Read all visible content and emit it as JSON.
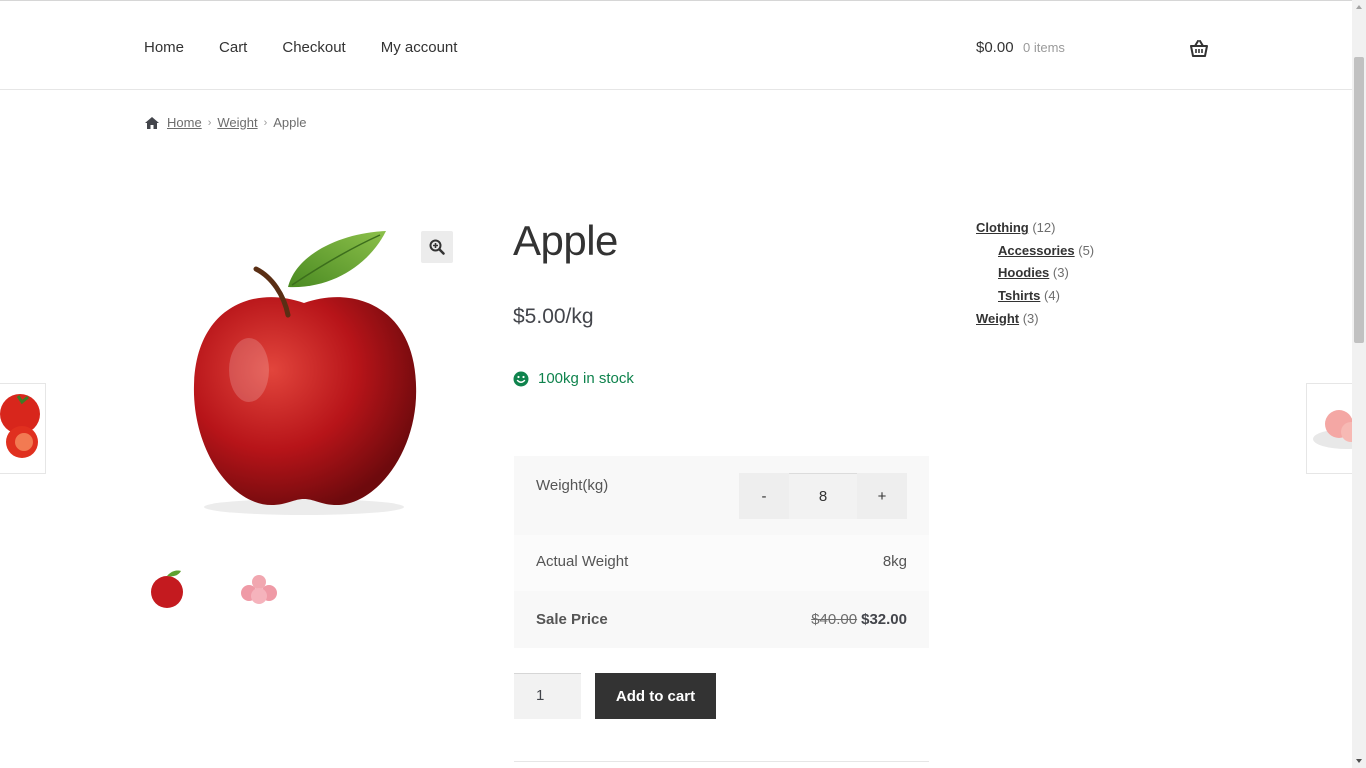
{
  "nav": {
    "items": [
      {
        "label": "Home"
      },
      {
        "label": "Cart"
      },
      {
        "label": "Checkout"
      },
      {
        "label": "My account"
      }
    ]
  },
  "mini_cart": {
    "amount": "$0.00",
    "count": "0 items",
    "icon": "basket-icon"
  },
  "breadcrumb": {
    "icon": "home-icon",
    "items": [
      "Home",
      "Weight",
      "Apple"
    ]
  },
  "product": {
    "title": "Apple",
    "price": "$5.00/kg",
    "stock": "100kg in stock",
    "weight_label": "Weight(kg)",
    "weight_minus": "-",
    "weight_value": "8",
    "weight_plus": "+",
    "actual_weight_label": "Actual Weight",
    "actual_weight_value": "8kg",
    "sale_price_label": "Sale Price",
    "old_price": "$40.00",
    "new_price": "$32.00",
    "quantity": "1",
    "add_to_cart": "Add to cart"
  },
  "categories": [
    {
      "label": "Clothing",
      "count": "(12)",
      "level": 0
    },
    {
      "label": "Accessories",
      "count": "(5)",
      "level": 1
    },
    {
      "label": "Hoodies",
      "count": "(3)",
      "level": 1
    },
    {
      "label": "Tshirts",
      "count": "(4)",
      "level": 1
    },
    {
      "label": "Weight",
      "count": "(3)",
      "level": 0
    }
  ],
  "colors": {
    "stock_green": "#0f834d",
    "button_dark": "#333333",
    "apple_red": "#c41a1f",
    "leaf_green": "#5fa030"
  }
}
